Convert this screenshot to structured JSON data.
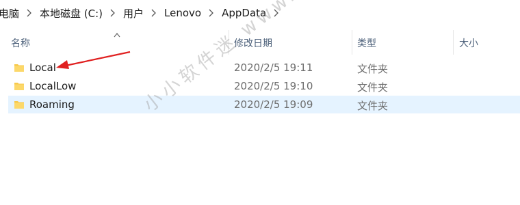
{
  "breadcrumb": {
    "items": [
      "电脑",
      "本地磁盘 (C:)",
      "用户",
      "Lenovo",
      "AppData"
    ]
  },
  "columns": {
    "name": "名称",
    "date_modified": "修改日期",
    "type": "类型",
    "size": "大小"
  },
  "rows": [
    {
      "name": "Local",
      "date": "2020/2/5 19:11",
      "type": "文件夹"
    },
    {
      "name": "LocalLow",
      "date": "2020/2/5 19:10",
      "type": "文件夹"
    },
    {
      "name": "Roaming",
      "date": "2020/2/5 19:09",
      "type": "文件夹"
    }
  ],
  "watermark": "小小软件迷 www.xxrjm.com",
  "colors": {
    "folder": "#f7c94b",
    "selected_row": "#cce8ff",
    "hover_row": "#e5f3ff",
    "header_text": "#4c607a",
    "annotation_arrow": "#e02020"
  },
  "icons": {
    "separator": "chevron-right-icon",
    "sort": "sort-ascending-icon",
    "folder": "folder-icon"
  }
}
